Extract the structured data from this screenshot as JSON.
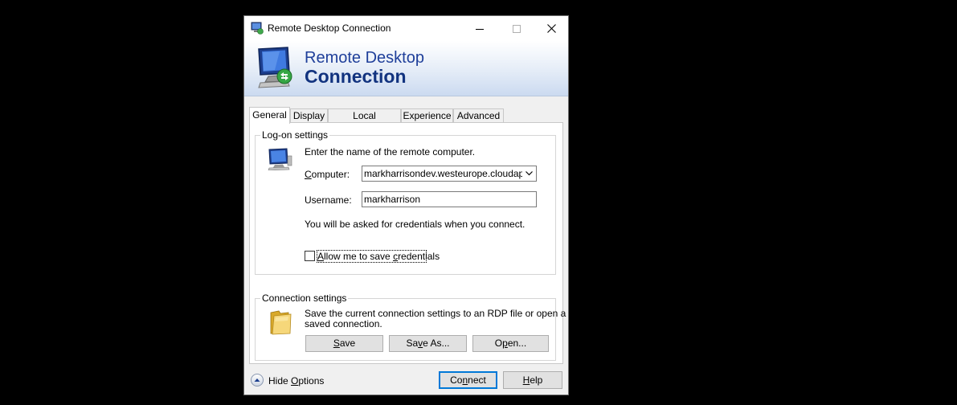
{
  "window": {
    "title": "Remote Desktop Connection",
    "icon": "rdp-computer-icon"
  },
  "banner": {
    "line1": "Remote Desktop",
    "line2": "Connection"
  },
  "tabs": [
    {
      "label": "General",
      "active": true
    },
    {
      "label": "Display",
      "active": false
    },
    {
      "label": "Local Resources",
      "active": false
    },
    {
      "label": "Experience",
      "active": false
    },
    {
      "label": "Advanced",
      "active": false
    }
  ],
  "logon": {
    "group_label": "Log-on settings",
    "instructions": "Enter the name of the remote computer.",
    "computer_label": "Computer:",
    "computer_value": "markharrisondev.westeurope.cloudapp.azure.com",
    "username_label": "Username:",
    "username_value": "markharrison",
    "credentials_note": "You will be asked for credentials when you connect.",
    "save_credentials_label": "Allow me to save credentials",
    "save_credentials_checked": false
  },
  "connection": {
    "group_label": "Connection settings",
    "description_line1": "Save the current connection settings to an RDP file or open a",
    "description_line2": "saved connection.",
    "save_button": "Save",
    "save_as_button": "Save As...",
    "open_button": "Open..."
  },
  "footer": {
    "hide_options": "Hide Options",
    "connect_button": "Connect",
    "help_button": "Help"
  },
  "colors": {
    "accent": "#0078d7",
    "banner_text": "#1f3f9a"
  }
}
